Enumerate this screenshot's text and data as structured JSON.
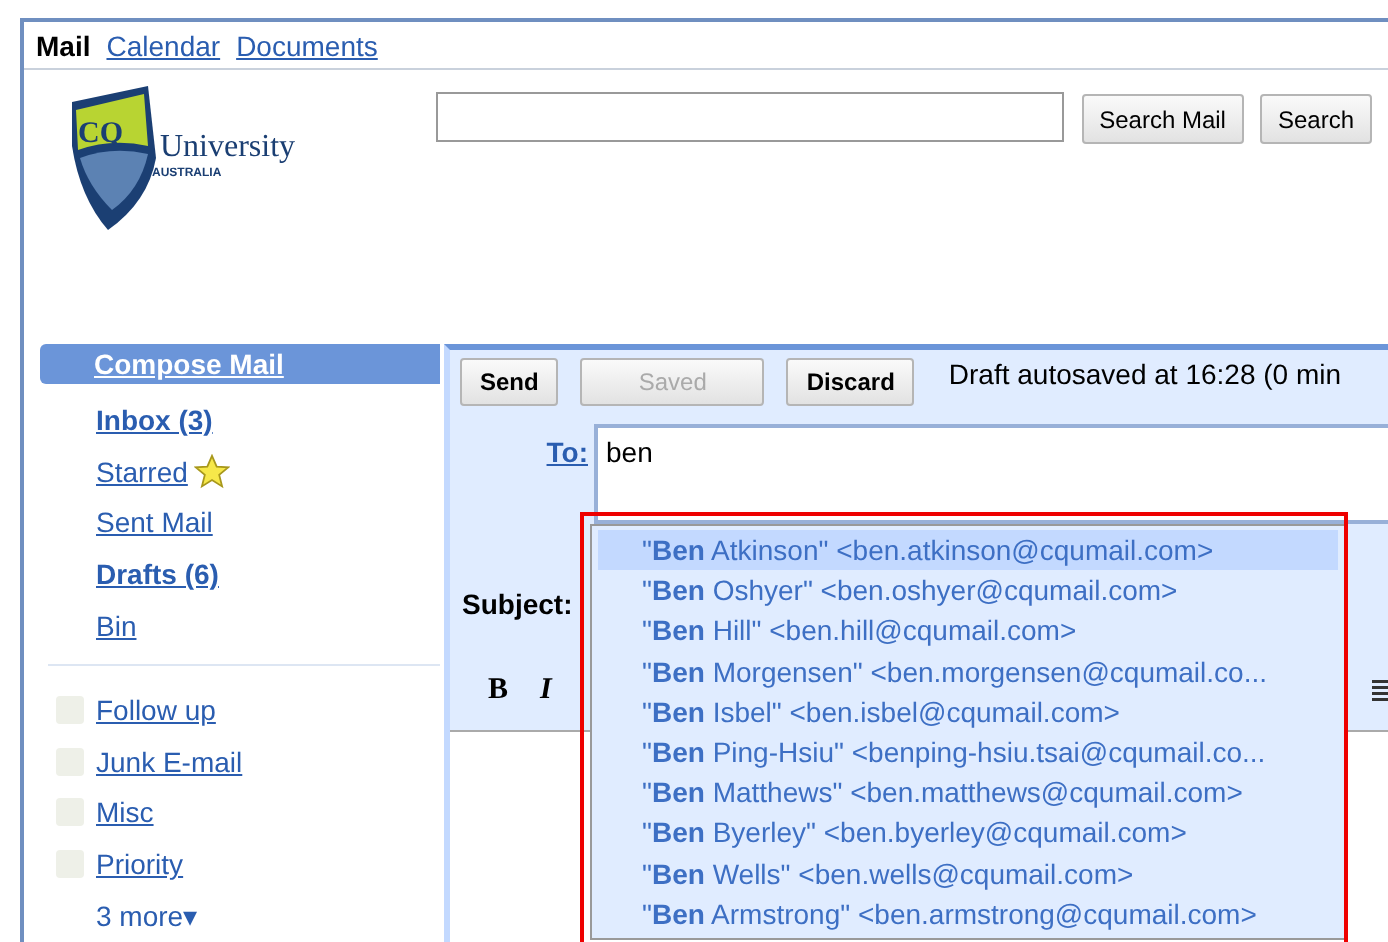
{
  "top_nav": [
    {
      "label": "Mail",
      "selected": true
    },
    {
      "label": "Calendar",
      "selected": false
    },
    {
      "label": "Documents",
      "selected": false
    }
  ],
  "logo": {
    "mark": "CQ",
    "name": "University",
    "country": "AUSTRALIA"
  },
  "search": {
    "buttons": [
      "Search Mail",
      "Search"
    ]
  },
  "sidebar": {
    "compose": "Compose Mail",
    "items": [
      {
        "label": "Inbox (3)",
        "unread": true,
        "kind": "folder"
      },
      {
        "label": "Starred",
        "unread": false,
        "kind": "starred"
      },
      {
        "label": "Sent Mail",
        "unread": false,
        "kind": "folder"
      },
      {
        "label": "Drafts (6)",
        "unread": true,
        "kind": "folder"
      },
      {
        "label": "Bin",
        "unread": false,
        "kind": "folder"
      }
    ],
    "labels": [
      "Follow up",
      "Junk E-mail",
      "Misc",
      "Priority"
    ],
    "more": "3 more▾"
  },
  "compose": {
    "buttons": [
      {
        "label": "Send",
        "disabled": false
      },
      {
        "label": "Saved",
        "disabled": true
      },
      {
        "label": "Discard",
        "disabled": false
      }
    ],
    "status": "Draft autosaved at 16:28 (0 min",
    "to_label": "To:",
    "to_value": "ben",
    "subject_label": "Subject:",
    "format_buttons": [
      "B",
      "I"
    ]
  },
  "suggestions": [
    {
      "text": "\"**Ben** Atkinson\" <ben.atkinson@cqumail.com>",
      "selected": true
    },
    {
      "text": "\"**Ben** Oshyer\" <ben.oshyer@cqumail.com>",
      "selected": false
    },
    {
      "text": "\"**Ben** Hill\" <ben.hill@cqumail.com>",
      "selected": false
    },
    {
      "text": "\"**Ben** Morgensen\" <ben.morgensen@cqumail.co...",
      "selected": false
    },
    {
      "text": "\"**Ben** Isbel\" <ben.isbel@cqumail.com>",
      "selected": false
    },
    {
      "text": "\"**Ben** Ping-Hsiu\" <benping-hsiu.tsai@cqumail.co...",
      "selected": false
    },
    {
      "text": "\"**Ben** Matthews\" <ben.matthews@cqumail.com>",
      "selected": false
    },
    {
      "text": "\"**Ben** Byerley\" <ben.byerley@cqumail.com>",
      "selected": false
    },
    {
      "text": "\"**Ben** Wells\" <ben.wells@cqumail.com>",
      "selected": false
    },
    {
      "text": "\"**Ben** Armstrong\" <ben.armstrong@cqumail.com>",
      "selected": false
    }
  ]
}
